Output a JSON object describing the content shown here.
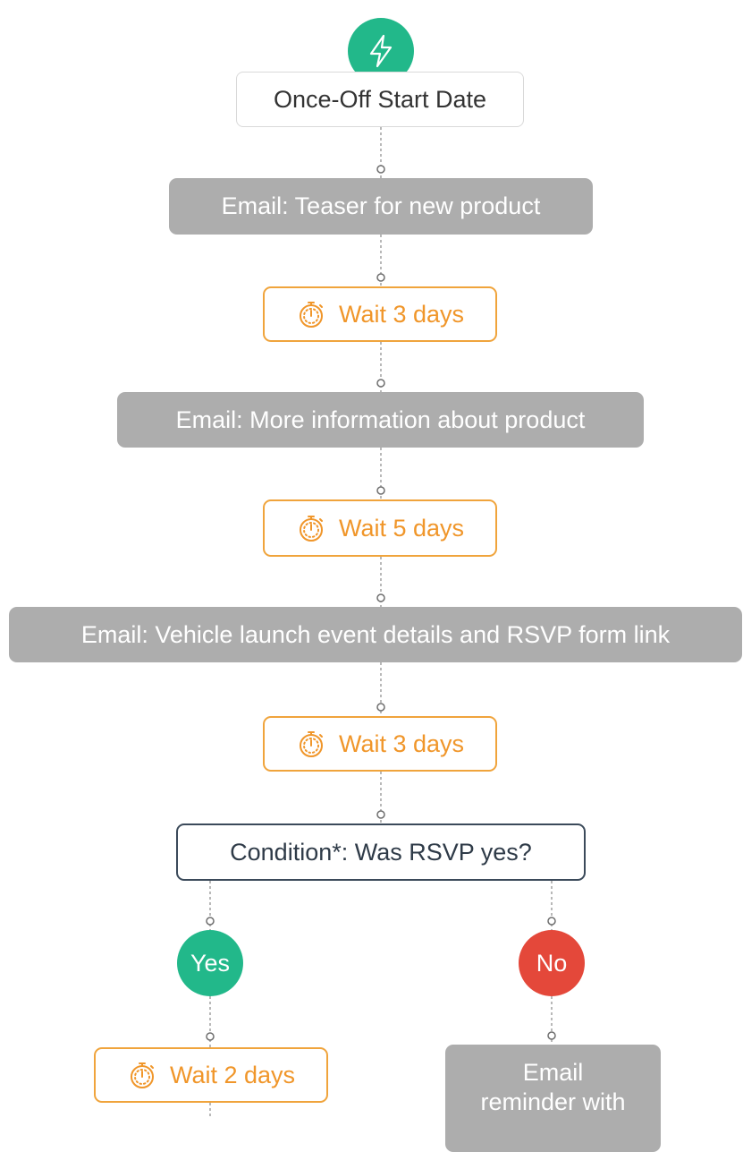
{
  "trigger": {
    "label": "Once-Off Start Date",
    "icon": "lightning-icon"
  },
  "steps": {
    "email_teaser": "Email: Teaser for new product",
    "wait_1": "Wait 3 days",
    "email_more_info": "Email: More information about product",
    "wait_2": "Wait 5 days",
    "email_launch": "Email: Vehicle launch event details and RSVP form link",
    "wait_3": "Wait 3 days",
    "condition": "Condition*: Was RSVP yes?"
  },
  "branches": {
    "yes": {
      "label": "Yes",
      "wait": "Wait 2 days"
    },
    "no": {
      "label": "No",
      "email_line1": "Email",
      "email_line2": "reminder with"
    }
  },
  "icons": {
    "wait": "stopwatch-icon",
    "trigger": "lightning-icon"
  },
  "colors": {
    "trigger_green": "#22b88a",
    "yes_green": "#22b88a",
    "no_red": "#e4483a",
    "wait_orange": "#f0a43c",
    "email_gray": "#adadad",
    "condition_navy": "#3b4a5a"
  }
}
